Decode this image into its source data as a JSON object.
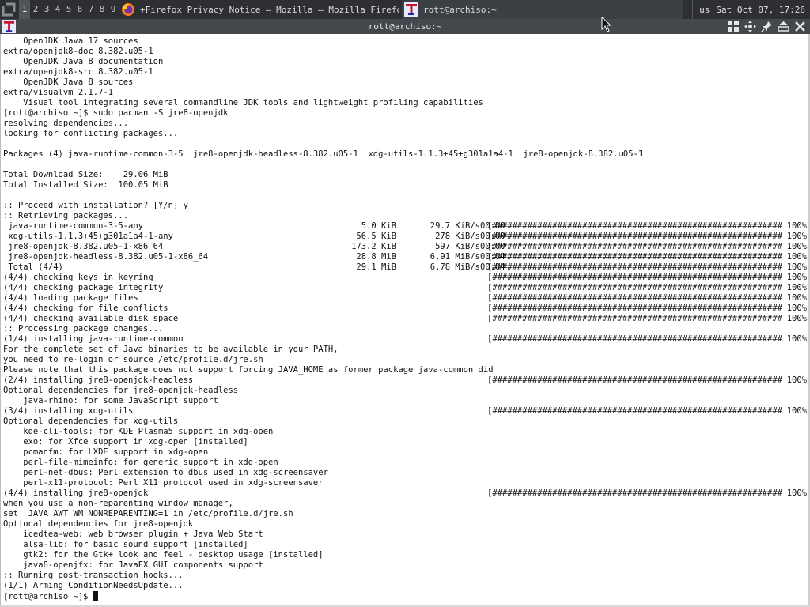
{
  "panel": {
    "workspaces": [
      "1",
      "2",
      "3",
      "4",
      "5",
      "6",
      "7",
      "8",
      "9"
    ],
    "active_workspace": "1",
    "tasks": [
      {
        "icon": "firefox-icon",
        "label": "+Firefox Privacy Notice — Mozilla — Mozilla Firefox"
      },
      {
        "icon": "terminal-icon",
        "label": "rott@archiso:~"
      }
    ],
    "keyboard_layout": "us",
    "clock": "Sat Oct 07, 17:26"
  },
  "window": {
    "title": "rott@archiso:~",
    "buttons": [
      "tile-icon",
      "move-icon",
      "pin-icon",
      "maximize-icon",
      "close-icon"
    ]
  },
  "colors": {
    "panel": "#2d2f33",
    "titlebar": "#44474c",
    "terminal_bg": "#ffffff",
    "text": "#111111"
  },
  "terminal": {
    "lines_before": [
      "    OpenJDK Java 17 sources",
      "extra/openjdk8-doc 8.382.u05-1",
      "    OpenJDK Java 8 documentation",
      "extra/openjdk8-src 8.382.u05-1",
      "    OpenJDK Java 8 sources",
      "extra/visualvm 2.1.7-1",
      "    Visual tool integrating several commandline JDK tools and lightweight profiling capabilities",
      "[rott@archiso ~]$ sudo pacman -S jre8-openjdk",
      "resolving dependencies...",
      "looking for conflicting packages...",
      "",
      "Packages (4) java-runtime-common-3-5  jre8-openjdk-headless-8.382.u05-1  xdg-utils-1.1.3+45+g301a1a4-1  jre8-openjdk-8.382.u05-1",
      "",
      "Total Download Size:    29.06 MiB",
      "Total Installed Size:  100.05 MiB",
      "",
      ":: Proceed with installation? [Y/n] y",
      ":: Retrieving packages..."
    ],
    "progress_bar": "[######################################################################]",
    "downloads": [
      {
        "name": " java-runtime-common-3-5-any",
        "size": "5.0 KiB",
        "speed": "29.7 KiB/s",
        "time": "00:00",
        "pct": "100%"
      },
      {
        "name": " xdg-utils-1.1.3+45+g301a1a4-1-any",
        "size": "56.5 KiB",
        "speed": "278 KiB/s",
        "time": "00:00",
        "pct": "100%"
      },
      {
        "name": " jre8-openjdk-8.382.u05-1-x86_64",
        "size": "173.2 KiB",
        "speed": "597 KiB/s",
        "time": "00:00",
        "pct": "100%"
      },
      {
        "name": " jre8-openjdk-headless-8.382.u05-1-x86_64",
        "size": "28.8 MiB",
        "speed": "6.91 MiB/s",
        "time": "00:04",
        "pct": "100%"
      },
      {
        "name": " Total (4/4)",
        "size": "29.1 MiB",
        "speed": "6.78 MiB/s",
        "time": "00:04",
        "pct": "100%"
      }
    ],
    "checks": [
      {
        "text": "(4/4) checking keys in keyring",
        "pct": "100%"
      },
      {
        "text": "(4/4) checking package integrity",
        "pct": "100%"
      },
      {
        "text": "(4/4) loading package files",
        "pct": "100%"
      },
      {
        "text": "(4/4) checking for file conflicts",
        "pct": "100%"
      },
      {
        "text": "(4/4) checking available disk space",
        "pct": "100%"
      }
    ],
    "lines_after": [
      {
        "text": ":: Processing package changes..."
      },
      {
        "text": "(1/4) installing java-runtime-common",
        "bar": true,
        "pct": "100%"
      },
      {
        "text": "For the complete set of Java binaries to be available in your PATH,"
      },
      {
        "text": "you need to re-login or source /etc/profile.d/jre.sh"
      },
      {
        "text": "Please note that this package does not support forcing JAVA_HOME as former package java-common did"
      },
      {
        "text": "(2/4) installing jre8-openjdk-headless",
        "bar": true,
        "pct": "100%"
      },
      {
        "text": "Optional dependencies for jre8-openjdk-headless"
      },
      {
        "text": "    java-rhino: for some JavaScript support"
      },
      {
        "text": "(3/4) installing xdg-utils",
        "bar": true,
        "pct": "100%"
      },
      {
        "text": "Optional dependencies for xdg-utils"
      },
      {
        "text": "    kde-cli-tools: for KDE Plasma5 support in xdg-open"
      },
      {
        "text": "    exo: for Xfce support in xdg-open [installed]"
      },
      {
        "text": "    pcmanfm: for LXDE support in xdg-open"
      },
      {
        "text": "    perl-file-mimeinfo: for generic support in xdg-open"
      },
      {
        "text": "    perl-net-dbus: Perl extension to dbus used in xdg-screensaver"
      },
      {
        "text": "    perl-x11-protocol: Perl X11 protocol used in xdg-screensaver"
      },
      {
        "text": "(4/4) installing jre8-openjdk",
        "bar": true,
        "pct": "100%"
      },
      {
        "text": "when you use a non-reparenting window manager,"
      },
      {
        "text": "set _JAVA_AWT_WM_NONREPARENTING=1 in /etc/profile.d/jre.sh"
      },
      {
        "text": "Optional dependencies for jre8-openjdk"
      },
      {
        "text": "    icedtea-web: web browser plugin + Java Web Start"
      },
      {
        "text": "    alsa-lib: for basic sound support [installed]"
      },
      {
        "text": "    gtk2: for the Gtk+ look and feel - desktop usage [installed]"
      },
      {
        "text": "    java8-openjfx: for JavaFX GUI components support"
      },
      {
        "text": ":: Running post-transaction hooks..."
      },
      {
        "text": "(1/1) Arming ConditionNeedsUpdate..."
      }
    ],
    "prompt": "[rott@archiso ~]$ "
  }
}
